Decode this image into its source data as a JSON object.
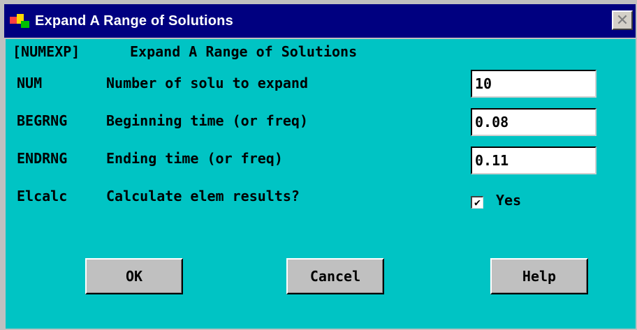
{
  "window": {
    "title": "Expand A Range of Solutions",
    "close_glyph": "✕",
    "colors": {
      "titlebar": "#000080",
      "client": "#00c4c4",
      "button_face": "#c0c0c0"
    }
  },
  "header": {
    "command": "[NUMEXP]",
    "description": "Expand A Range of Solutions"
  },
  "rows": [
    {
      "key": "NUM",
      "label": "Number of solu to expand",
      "value": "10"
    },
    {
      "key": "BEGRNG",
      "label": "Beginning time (or freq)",
      "value": "0.08"
    },
    {
      "key": "ENDRNG",
      "label": "Ending time (or freq)",
      "value": "0.11"
    },
    {
      "key": "Elcalc",
      "label": "Calculate elem results?",
      "checkbox_label": "Yes",
      "checked": true,
      "check_glyph": "✔"
    }
  ],
  "buttons": {
    "ok": "OK",
    "cancel": "Cancel",
    "help": "Help"
  }
}
